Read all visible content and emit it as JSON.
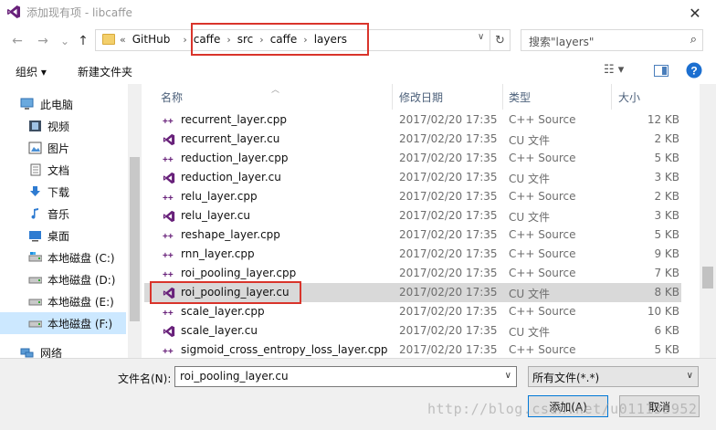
{
  "window": {
    "title": "添加现有项 - libcaffe",
    "close_glyph": "✕"
  },
  "navigation": {
    "back_glyph": "←",
    "forward_glyph": "→",
    "recent_glyph": "⌄",
    "up_glyph": "↑"
  },
  "address": {
    "overflow": "«",
    "crumbs": [
      "GitHub",
      "caffe",
      "src",
      "caffe",
      "layers"
    ],
    "separator": "›",
    "refresh_glyph": "↻"
  },
  "search": {
    "placeholder": "搜索\"layers\""
  },
  "toolbar": {
    "organize_label": "组织 ▾",
    "new_folder_label": "新建文件夹",
    "help_glyph": "?"
  },
  "sidebar": {
    "items": [
      {
        "label": "此电脑",
        "icon": "pc-icon"
      },
      {
        "label": "视频",
        "icon": "videos-icon"
      },
      {
        "label": "图片",
        "icon": "pictures-icon"
      },
      {
        "label": "文档",
        "icon": "documents-icon"
      },
      {
        "label": "下载",
        "icon": "downloads-icon"
      },
      {
        "label": "音乐",
        "icon": "music-icon"
      },
      {
        "label": "桌面",
        "icon": "desktop-icon"
      },
      {
        "label": "本地磁盘 (C:)",
        "icon": "drive-c-icon"
      },
      {
        "label": "本地磁盘 (D:)",
        "icon": "drive-icon"
      },
      {
        "label": "本地磁盘 (E:)",
        "icon": "drive-icon"
      },
      {
        "label": "本地磁盘 (F:)",
        "icon": "drive-icon"
      },
      {
        "label": "网络",
        "icon": "network-icon"
      }
    ],
    "selected_index": 10
  },
  "columns": {
    "name": "名称",
    "date": "修改日期",
    "type": "类型",
    "size": "大小"
  },
  "files": [
    {
      "name": "recurrent_layer.cpp",
      "date": "2017/02/20 17:35",
      "type": "C++ Source",
      "size": "12 KB",
      "kind": "cpp"
    },
    {
      "name": "recurrent_layer.cu",
      "date": "2017/02/20 17:35",
      "type": "CU 文件",
      "size": "2 KB",
      "kind": "cu"
    },
    {
      "name": "reduction_layer.cpp",
      "date": "2017/02/20 17:35",
      "type": "C++ Source",
      "size": "5 KB",
      "kind": "cpp"
    },
    {
      "name": "reduction_layer.cu",
      "date": "2017/02/20 17:35",
      "type": "CU 文件",
      "size": "3 KB",
      "kind": "cu"
    },
    {
      "name": "relu_layer.cpp",
      "date": "2017/02/20 17:35",
      "type": "C++ Source",
      "size": "2 KB",
      "kind": "cpp"
    },
    {
      "name": "relu_layer.cu",
      "date": "2017/02/20 17:35",
      "type": "CU 文件",
      "size": "3 KB",
      "kind": "cu"
    },
    {
      "name": "reshape_layer.cpp",
      "date": "2017/02/20 17:35",
      "type": "C++ Source",
      "size": "5 KB",
      "kind": "cpp"
    },
    {
      "name": "rnn_layer.cpp",
      "date": "2017/02/20 17:35",
      "type": "C++ Source",
      "size": "9 KB",
      "kind": "cpp"
    },
    {
      "name": "roi_pooling_layer.cpp",
      "date": "2017/02/20 17:35",
      "type": "C++ Source",
      "size": "7 KB",
      "kind": "cpp"
    },
    {
      "name": "roi_pooling_layer.cu",
      "date": "2017/02/20 17:35",
      "type": "CU 文件",
      "size": "8 KB",
      "kind": "cu"
    },
    {
      "name": "scale_layer.cpp",
      "date": "2017/02/20 17:35",
      "type": "C++ Source",
      "size": "10 KB",
      "kind": "cpp"
    },
    {
      "name": "scale_layer.cu",
      "date": "2017/02/20 17:35",
      "type": "CU 文件",
      "size": "6 KB",
      "kind": "cu"
    },
    {
      "name": "sigmoid_cross_entropy_loss_layer.cpp",
      "date": "2017/02/20 17:35",
      "type": "C++ Source",
      "size": "5 KB",
      "kind": "cpp"
    }
  ],
  "selected_file_index": 9,
  "bottom": {
    "filename_label": "文件名(N):",
    "filename_value": "roi_pooling_layer.cu",
    "filetype_value": "所有文件(*.*)",
    "add_label": "添加(A)",
    "cancel_label": "取消"
  },
  "watermark": "http://blog.csdn.net/u011135952",
  "colors": {
    "highlight_box": "#d9342b",
    "selected_row": "#d9d9d9",
    "selected_sidebar": "#cce8ff",
    "vs_purple": "#68217a"
  }
}
